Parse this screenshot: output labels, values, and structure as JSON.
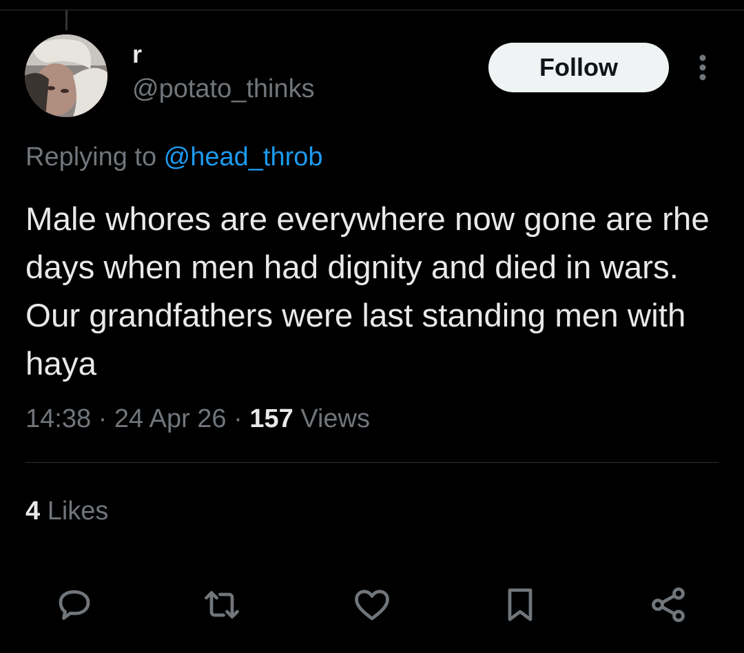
{
  "tweet": {
    "display_name": "r",
    "handle": "@potato_thinks",
    "follow_label": "Follow",
    "replying_prefix": "Replying to ",
    "replying_handle": "@head_throb",
    "text": "Male whores are everywhere now gone are rhe days when men had dignity and died in wars. Our grandfathers were last standing men with haya",
    "time": "14:38",
    "date": "24 Apr 26",
    "separator": "·",
    "views_count": "157",
    "views_label": "Views",
    "likes_count": "4",
    "likes_label": "Likes"
  },
  "actions": [
    "reply-icon",
    "retweet-icon",
    "like-icon",
    "bookmark-icon",
    "share-icon"
  ],
  "colors": {
    "background": "#000000",
    "text_primary": "#e7e9ea",
    "text_secondary": "#71767b",
    "link": "#1d9bf0",
    "divider": "#2f3336",
    "follow_bg": "#eff3f4"
  }
}
